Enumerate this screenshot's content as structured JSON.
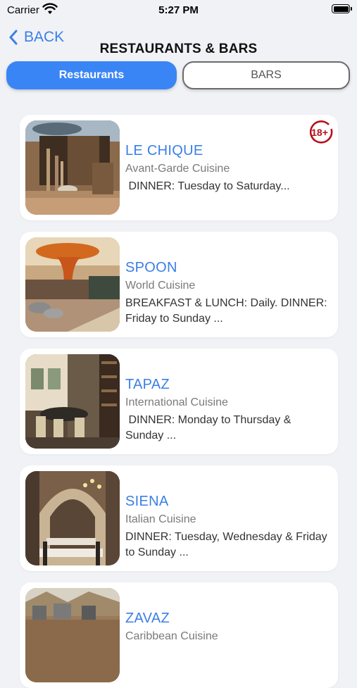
{
  "status_bar": {
    "carrier": "Carrier",
    "time": "5:27 PM"
  },
  "nav": {
    "back_label": "BACK",
    "title": "RESTAURANTS & BARS"
  },
  "tabs": [
    {
      "label": "Restaurants",
      "active": true
    },
    {
      "label": "BARS",
      "active": false
    }
  ],
  "colors": {
    "accent": "#3a85f5",
    "link": "#3a7fe6",
    "background": "#f1f2f6",
    "badge_red": "#b5121b"
  },
  "restaurants": [
    {
      "name": "LE CHIQUE",
      "cuisine": "Avant-Garde Cuisine",
      "hours": " DINNER: Tuesday to Saturday...",
      "badge": "18+"
    },
    {
      "name": "SPOON",
      "cuisine": "World Cuisine",
      "hours": "BREAKFAST & LUNCH: Daily. DINNER: Friday to Sunday ..."
    },
    {
      "name": "TAPAZ",
      "cuisine": "International Cuisine",
      "hours": " DINNER: Monday to Thursday & Sunday ..."
    },
    {
      "name": "SIENA",
      "cuisine": "Italian Cuisine",
      "hours": "DINNER: Tuesday, Wednesday & Friday to Sunday ..."
    },
    {
      "name": "ZAVAZ",
      "cuisine": "Caribbean Cuisine",
      "hours": ""
    }
  ]
}
